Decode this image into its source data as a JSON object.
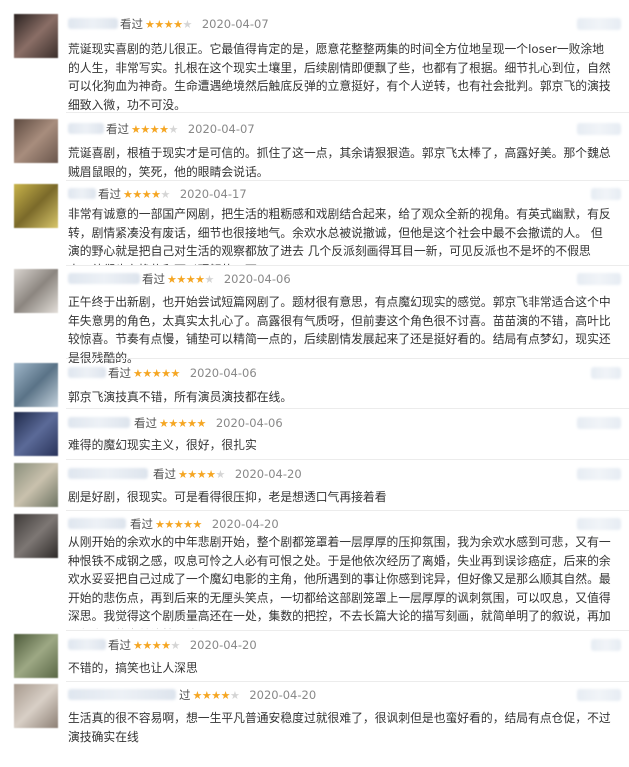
{
  "reviews": [
    {
      "verb": "看过",
      "stars": 4,
      "date": "2020-04-07",
      "text": "荒诞现实喜剧的范儿很正。它最值得肯定的是，愿意花整整两集的时间全方位地呈现一个loser一败涂地的人生，非常写实。扎根在这个现实土壤里，后续剧情即便飘了些，也都有了根据。细节扎心到位，自然可以化狗血为神奇。生命遭遇绝境然后触底反弹的立意挺好，有个人逆转，也有社会批判。郭京飞的演技细致入微，功不可没。"
    },
    {
      "verb": "看过",
      "stars": 4,
      "date": "2020-04-07",
      "text": "荒诞喜剧，根植于现实才是可信的。抓住了这一点，其余请狠狠造。郭京飞太棒了，高露好美。那个魏总贼眉鼠眼的，笑死，他的眼睛会说话。"
    },
    {
      "verb": "看过",
      "stars": 4,
      "date": "2020-04-17",
      "text": "非常有诚意的一部国产网剧，把生活的粗粝感和戏剧结合起来，给了观众全新的视角。有英式幽默，有反转，剧情紧凑没有废话，细节也很接地气。余欢水总被说撤诚，但他是这个社会中最不会撤谎的人。 但演的野心就是把自己对生活的观察都放了进去 几个反派刻画得耳目一新，可见反派也不是坏的不假思索，他们也有挣扎和可以理解的一面"
    },
    {
      "verb": "看过",
      "stars": 4,
      "date": "2020-04-06",
      "text": "正午终于出新剧，也开始尝试短篇网剧了。题材很有意思，有点魔幻现实的感觉。郭京飞非常适合这个中年失意男的角色，太真实太扎心了。高露很有气质呀，但前妻这个角色很不讨喜。苗苗演的不错，高叶比较惊喜。节奏有点慢，铺垫可以精简一点的，后续剧情发展起来了还是挺好看的。结局有点梦幻，现实还是很残酷的。"
    },
    {
      "verb": "看过",
      "stars": 5,
      "date": "2020-04-06",
      "text": "郭京飞演技真不错，所有演员演技都在线。"
    },
    {
      "verb": "看过",
      "stars": 5,
      "date": "2020-04-06",
      "text": "难得的魔幻现实主义，很好，很扎实"
    },
    {
      "verb": "看过",
      "stars": 4,
      "date": "2020-04-20",
      "text": "剧是好剧，很现实。可是看得很压抑，老是想透口气再接着看"
    },
    {
      "verb": "看过",
      "stars": 5,
      "date": "2020-04-20",
      "text": "从刚开始的余欢水的中年悲剧开始，整个剧都笼罩着一层厚厚的压抑氛围，我为余欢水感到可悲，又有一种恨铁不成钢之感，叹息可怜之人必有可恨之处。于是他依次经历了离婚，失业再到误诊癌症，后来的余欢水妥妥把自己过成了一个魔幻电影的主角，他所遇到的事让你感到诧异，但好像又是那么顺其自然。最开始的悲伤点，再到后来的无厘头笑点，一切都给这部剧笼罩上一层厚厚的讽刺氛围，可以叹息，又值得深思。我觉得这个剧质量高还在一处，集数的把控，不去长篇大论的描写刻画，就简单明了的叙说，再加上郭京飞的完美演技，绝。"
    },
    {
      "verb": "看过",
      "stars": 4,
      "date": "2020-04-20",
      "text": "不错的，搞笑也让人深思"
    },
    {
      "verb": "过",
      "stars": 4,
      "date": "2020-04-20",
      "text": "生活真的很不容易啊，想一生平凡普通安稳度过就很难了，很讽刺但是也蛮好看的，结局有点仓促，不过演技确实在线"
    }
  ]
}
